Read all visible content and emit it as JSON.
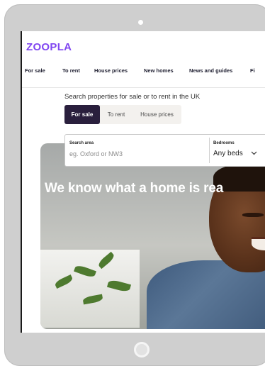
{
  "brand": {
    "logo": "ZOOPLA",
    "color": "#8046f1"
  },
  "nav": {
    "items": [
      "For sale",
      "To rent",
      "House prices",
      "New homes",
      "News and guides",
      "Fi"
    ]
  },
  "search": {
    "title": "Search properties for sale or to rent in the UK",
    "tabs": [
      "For sale",
      "To rent",
      "House prices"
    ],
    "active_tab": "For sale",
    "area_label": "Search area",
    "area_placeholder": "eg. Oxford or NW3",
    "bedrooms_label": "Bedrooms",
    "bedrooms_value": "Any beds"
  },
  "hero": {
    "headline": "We know what a home is rea"
  },
  "icons": {
    "dropdown": "chevron-down-icon"
  }
}
